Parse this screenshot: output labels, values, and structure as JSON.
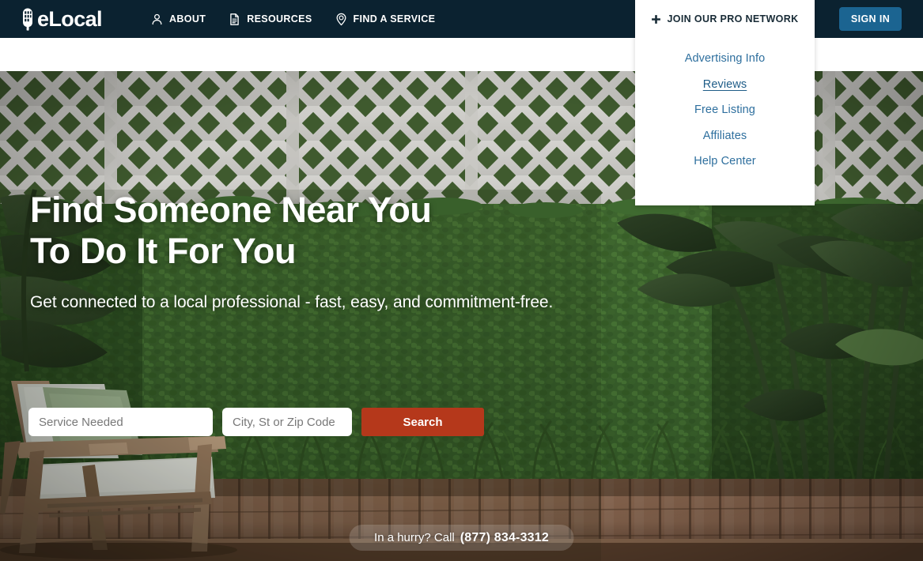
{
  "header": {
    "logo": {
      "text": "eLocal",
      "icon": "elocal-logo-icon"
    },
    "nav": [
      {
        "label": "ABOUT",
        "icon": "person-icon"
      },
      {
        "label": "RESOURCES",
        "icon": "document-icon"
      },
      {
        "label": "FIND A SERVICE",
        "icon": "map-pin-icon"
      }
    ],
    "signin_label": "SIGN IN",
    "colors": {
      "header_bg": "#0b2230",
      "signin_bg": "#1b6491"
    }
  },
  "dropdown": {
    "trigger_label": "JOIN OUR PRO NETWORK",
    "trigger_icon": "plus-icon",
    "items": [
      {
        "label": "Advertising Info",
        "active": false
      },
      {
        "label": "Reviews",
        "active": true
      },
      {
        "label": "Free Listing",
        "active": false
      },
      {
        "label": "Affiliates",
        "active": false
      },
      {
        "label": "Help Center",
        "active": false
      }
    ],
    "link_color": "#2e6f9e"
  },
  "hero": {
    "title": "Find Someone Near You\nTo Do It For You",
    "subtitle": "Get connected to a local professional - fast, easy, and commitment-free.",
    "search": {
      "service_placeholder": "Service Needed",
      "service_value": "",
      "location_placeholder": "City, St or Zip Code",
      "location_value": "",
      "button_label": "Search",
      "button_color": "#b5381b"
    },
    "call_banner": {
      "label": "In a hurry? Call",
      "number": "(877) 834-3312"
    }
  }
}
